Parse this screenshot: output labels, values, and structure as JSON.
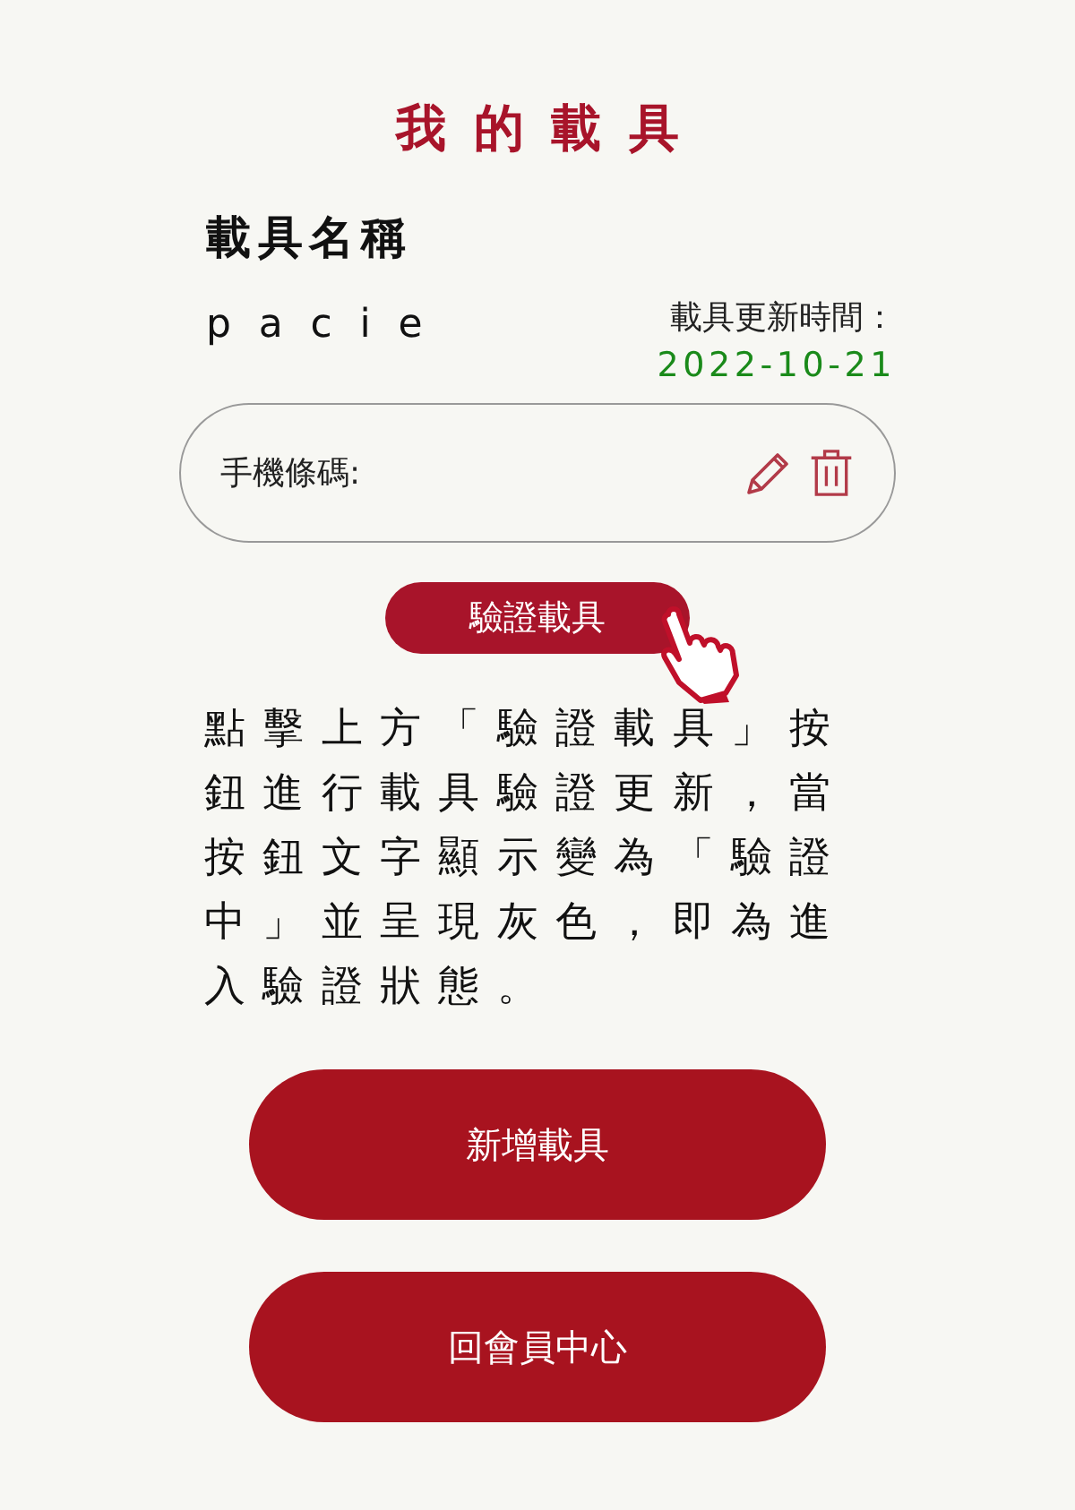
{
  "title": "我的載具",
  "carrier": {
    "heading": "載具名稱",
    "name": "pacie",
    "updated_label": "載具更新時間：",
    "updated_date": "2022-10-21"
  },
  "barcode_field": {
    "label": "手機條碼:"
  },
  "verify_button": "驗證載具",
  "instructions": "點擊上方「驗證載具」按鈕進行載具驗證更新，當按鈕文字顯示變為「驗證中」並呈現灰色，即為進入驗證狀態。",
  "buttons": [
    "新增載具",
    "回會員中心"
  ]
}
